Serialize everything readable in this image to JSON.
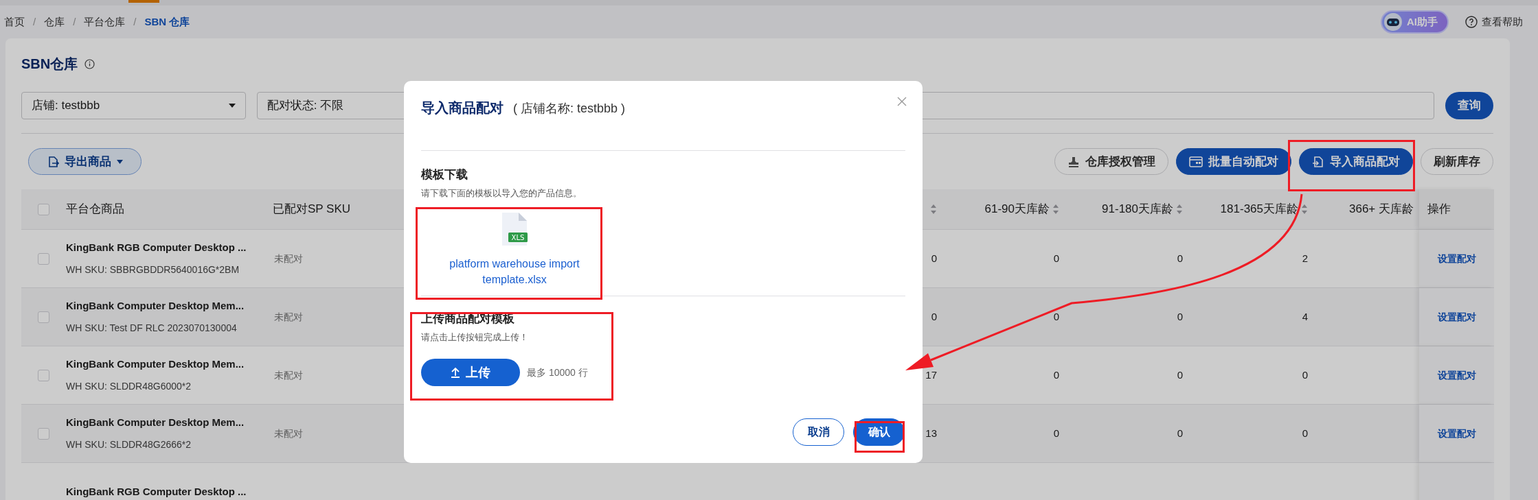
{
  "breadcrumb": [
    {
      "label": "首页",
      "selected": false
    },
    {
      "separator": "/",
      "label": "仓库",
      "selected": false
    },
    {
      "separator": "/",
      "label": "平台仓库",
      "selected": false
    },
    {
      "separator": "/",
      "label": "SBN 仓库",
      "selected": true
    }
  ],
  "header_actions": {
    "ai_assistant": "AI助手",
    "help": "查看帮助"
  },
  "page_title": "SBN仓库",
  "filters": {
    "store": "店铺: testbbb",
    "pair_status": "配对状态: 不限",
    "search_button": "查询"
  },
  "toolbar": {
    "export_button": "导出商品",
    "actions": [
      {
        "label": "仓库授权管理",
        "kind": "outline"
      },
      {
        "label": "批量自动配对",
        "kind": "primary"
      },
      {
        "label": "导入商品配对",
        "kind": "primary"
      },
      {
        "label": "刷新库存",
        "kind": "outline"
      }
    ]
  },
  "table": {
    "select_all": {
      "checked": false
    },
    "columns": [
      {
        "label": "平台仓商品",
        "sortable": false
      },
      {
        "label": "已配对SP SKU",
        "sortable": false
      },
      {
        "sortable": true
      },
      {
        "label": "61-90天库龄",
        "sortable": true
      },
      {
        "label": "91-180天库龄",
        "sortable": true
      },
      {
        "label": "181-365天库龄",
        "sortable": true
      },
      {
        "label": "366+ 天库龄",
        "sortable": false
      },
      {
        "label": "操作",
        "sortable": false
      }
    ],
    "rows": [
      {
        "checked": false,
        "product": "KingBank RGB Computer Desktop ...",
        "wh_sku": "WH SKU: SBBRGBDDR5640016G*2BM",
        "pair_status": "未配对",
        "values": [
          "0",
          "0",
          "0",
          "2"
        ],
        "action": "设置配对"
      },
      {
        "checked": false,
        "product": "KingBank Computer Desktop Mem...",
        "wh_sku": "WH SKU: Test DF RLC 2023070130004",
        "pair_status": "未配对",
        "values": [
          "0",
          "0",
          "0",
          "4"
        ],
        "action": "设置配对"
      },
      {
        "checked": false,
        "product": "KingBank Computer Desktop Mem...",
        "wh_sku": "WH SKU: SLDDR48G6000*2",
        "pair_status": "未配对",
        "values": [
          "17",
          "0",
          "0",
          "0"
        ],
        "action": "设置配对"
      },
      {
        "checked": false,
        "product": "KingBank Computer Desktop Mem...",
        "wh_sku": "WH SKU: SLDDR48G2666*2",
        "pair_status": "未配对",
        "values": [
          "13",
          "0",
          "0",
          "0"
        ],
        "action": "设置配对"
      },
      {
        "product": "KingBank RGB Computer Desktop ..."
      }
    ]
  },
  "dialog": {
    "title": "导入商品配对",
    "subtitle": "( 店铺名称: testbbb )",
    "template_section": {
      "heading": "模板下载",
      "description": "请下载下面的模板以导入您的产品信息。",
      "file_badge": "XLS",
      "file_name": "platform warehouse import template.xlsx"
    },
    "upload_section": {
      "heading": "上传商品配对模板",
      "description": "请点击上传按钮完成上传！",
      "upload_button": "上传",
      "limit": "最多 10000 行"
    },
    "buttons": [
      {
        "label": "取消",
        "kind": "outline"
      },
      {
        "label": "确认",
        "kind": "primary"
      }
    ]
  }
}
